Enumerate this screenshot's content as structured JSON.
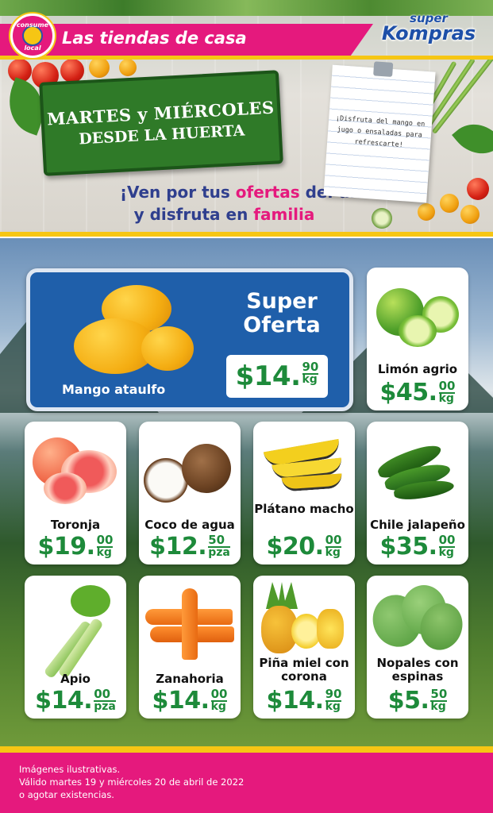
{
  "header": {
    "badge_top": "consume",
    "badge_bottom": "local",
    "tagline": "Las tiendas de casa",
    "brand_top": "super",
    "brand_main": "Kompras"
  },
  "promo": {
    "sign_line1": "MARTES y MIÉRCOLES",
    "sign_line2": "DESDE LA HUERTA",
    "headline_a": "¡Ven por tus ",
    "headline_a_em": "ofertas",
    "headline_a_b": " del día!",
    "headline_b": "y disfruta en ",
    "headline_b_em": "familia",
    "note": "¡Disfruta del mango en jugo o ensaladas para refrescarte!"
  },
  "offer": {
    "title_line1": "Super",
    "title_line2": "Oferta",
    "product": "Mango ataulfo",
    "price": "$14.",
    "cents": "90",
    "unit": "kg"
  },
  "products": [
    {
      "name": "Limón agrio",
      "price": "$45.",
      "cents": "00",
      "unit": "kg"
    },
    {
      "name": "Toronja",
      "price": "$19.",
      "cents": "00",
      "unit": "kg"
    },
    {
      "name": "Coco de agua",
      "price": "$12.",
      "cents": "50",
      "unit": "pza"
    },
    {
      "name": "Plátano macho",
      "price": "$20.",
      "cents": "00",
      "unit": "kg"
    },
    {
      "name": "Chile jalapeño",
      "price": "$35.",
      "cents": "00",
      "unit": "kg"
    },
    {
      "name": "Apio",
      "price": "$14.",
      "cents": "00",
      "unit": "pza"
    },
    {
      "name": "Zanahoria",
      "price": "$14.",
      "cents": "00",
      "unit": "kg"
    },
    {
      "name": "Piña miel con corona",
      "price": "$14.",
      "cents": "90",
      "unit": "kg"
    },
    {
      "name": "Nopales con espinas",
      "price": "$5.",
      "cents": "50",
      "unit": "kg"
    }
  ],
  "footer": {
    "line1": "Imágenes ilustrativas.",
    "line2": "Válido martes 19 y miércoles 20 de abril de 2022",
    "line3": "o agotar existencias."
  },
  "colors": {
    "pink": "#e5197d",
    "yellow": "#f6c614",
    "navy": "#2f3f8e",
    "price_green": "#1d8a3a",
    "offer_blue": "#1f5faa"
  }
}
